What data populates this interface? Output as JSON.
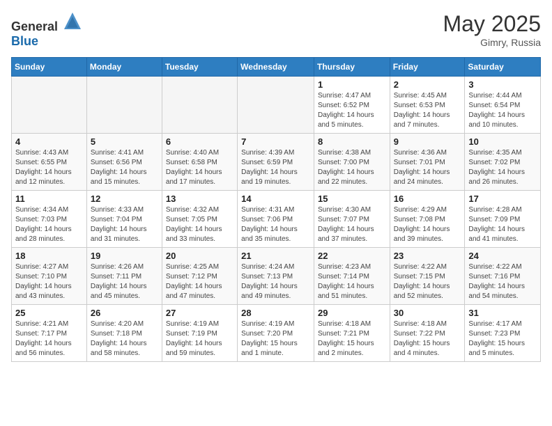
{
  "header": {
    "logo_general": "General",
    "logo_blue": "Blue",
    "month": "May 2025",
    "location": "Gimry, Russia"
  },
  "days_of_week": [
    "Sunday",
    "Monday",
    "Tuesday",
    "Wednesday",
    "Thursday",
    "Friday",
    "Saturday"
  ],
  "weeks": [
    [
      {
        "day": "",
        "empty": true
      },
      {
        "day": "",
        "empty": true
      },
      {
        "day": "",
        "empty": true
      },
      {
        "day": "",
        "empty": true
      },
      {
        "day": "1",
        "sunrise": "4:47 AM",
        "sunset": "6:52 PM",
        "daylight": "14 hours and 5 minutes."
      },
      {
        "day": "2",
        "sunrise": "4:45 AM",
        "sunset": "6:53 PM",
        "daylight": "14 hours and 7 minutes."
      },
      {
        "day": "3",
        "sunrise": "4:44 AM",
        "sunset": "6:54 PM",
        "daylight": "14 hours and 10 minutes."
      }
    ],
    [
      {
        "day": "4",
        "sunrise": "4:43 AM",
        "sunset": "6:55 PM",
        "daylight": "14 hours and 12 minutes."
      },
      {
        "day": "5",
        "sunrise": "4:41 AM",
        "sunset": "6:56 PM",
        "daylight": "14 hours and 15 minutes."
      },
      {
        "day": "6",
        "sunrise": "4:40 AM",
        "sunset": "6:58 PM",
        "daylight": "14 hours and 17 minutes."
      },
      {
        "day": "7",
        "sunrise": "4:39 AM",
        "sunset": "6:59 PM",
        "daylight": "14 hours and 19 minutes."
      },
      {
        "day": "8",
        "sunrise": "4:38 AM",
        "sunset": "7:00 PM",
        "daylight": "14 hours and 22 minutes."
      },
      {
        "day": "9",
        "sunrise": "4:36 AM",
        "sunset": "7:01 PM",
        "daylight": "14 hours and 24 minutes."
      },
      {
        "day": "10",
        "sunrise": "4:35 AM",
        "sunset": "7:02 PM",
        "daylight": "14 hours and 26 minutes."
      }
    ],
    [
      {
        "day": "11",
        "sunrise": "4:34 AM",
        "sunset": "7:03 PM",
        "daylight": "14 hours and 28 minutes."
      },
      {
        "day": "12",
        "sunrise": "4:33 AM",
        "sunset": "7:04 PM",
        "daylight": "14 hours and 31 minutes."
      },
      {
        "day": "13",
        "sunrise": "4:32 AM",
        "sunset": "7:05 PM",
        "daylight": "14 hours and 33 minutes."
      },
      {
        "day": "14",
        "sunrise": "4:31 AM",
        "sunset": "7:06 PM",
        "daylight": "14 hours and 35 minutes."
      },
      {
        "day": "15",
        "sunrise": "4:30 AM",
        "sunset": "7:07 PM",
        "daylight": "14 hours and 37 minutes."
      },
      {
        "day": "16",
        "sunrise": "4:29 AM",
        "sunset": "7:08 PM",
        "daylight": "14 hours and 39 minutes."
      },
      {
        "day": "17",
        "sunrise": "4:28 AM",
        "sunset": "7:09 PM",
        "daylight": "14 hours and 41 minutes."
      }
    ],
    [
      {
        "day": "18",
        "sunrise": "4:27 AM",
        "sunset": "7:10 PM",
        "daylight": "14 hours and 43 minutes."
      },
      {
        "day": "19",
        "sunrise": "4:26 AM",
        "sunset": "7:11 PM",
        "daylight": "14 hours and 45 minutes."
      },
      {
        "day": "20",
        "sunrise": "4:25 AM",
        "sunset": "7:12 PM",
        "daylight": "14 hours and 47 minutes."
      },
      {
        "day": "21",
        "sunrise": "4:24 AM",
        "sunset": "7:13 PM",
        "daylight": "14 hours and 49 minutes."
      },
      {
        "day": "22",
        "sunrise": "4:23 AM",
        "sunset": "7:14 PM",
        "daylight": "14 hours and 51 minutes."
      },
      {
        "day": "23",
        "sunrise": "4:22 AM",
        "sunset": "7:15 PM",
        "daylight": "14 hours and 52 minutes."
      },
      {
        "day": "24",
        "sunrise": "4:22 AM",
        "sunset": "7:16 PM",
        "daylight": "14 hours and 54 minutes."
      }
    ],
    [
      {
        "day": "25",
        "sunrise": "4:21 AM",
        "sunset": "7:17 PM",
        "daylight": "14 hours and 56 minutes."
      },
      {
        "day": "26",
        "sunrise": "4:20 AM",
        "sunset": "7:18 PM",
        "daylight": "14 hours and 58 minutes."
      },
      {
        "day": "27",
        "sunrise": "4:19 AM",
        "sunset": "7:19 PM",
        "daylight": "14 hours and 59 minutes."
      },
      {
        "day": "28",
        "sunrise": "4:19 AM",
        "sunset": "7:20 PM",
        "daylight": "15 hours and 1 minute."
      },
      {
        "day": "29",
        "sunrise": "4:18 AM",
        "sunset": "7:21 PM",
        "daylight": "15 hours and 2 minutes."
      },
      {
        "day": "30",
        "sunrise": "4:18 AM",
        "sunset": "7:22 PM",
        "daylight": "15 hours and 4 minutes."
      },
      {
        "day": "31",
        "sunrise": "4:17 AM",
        "sunset": "7:23 PM",
        "daylight": "15 hours and 5 minutes."
      }
    ]
  ],
  "labels": {
    "sunrise": "Sunrise:",
    "sunset": "Sunset:",
    "daylight": "Daylight:"
  }
}
